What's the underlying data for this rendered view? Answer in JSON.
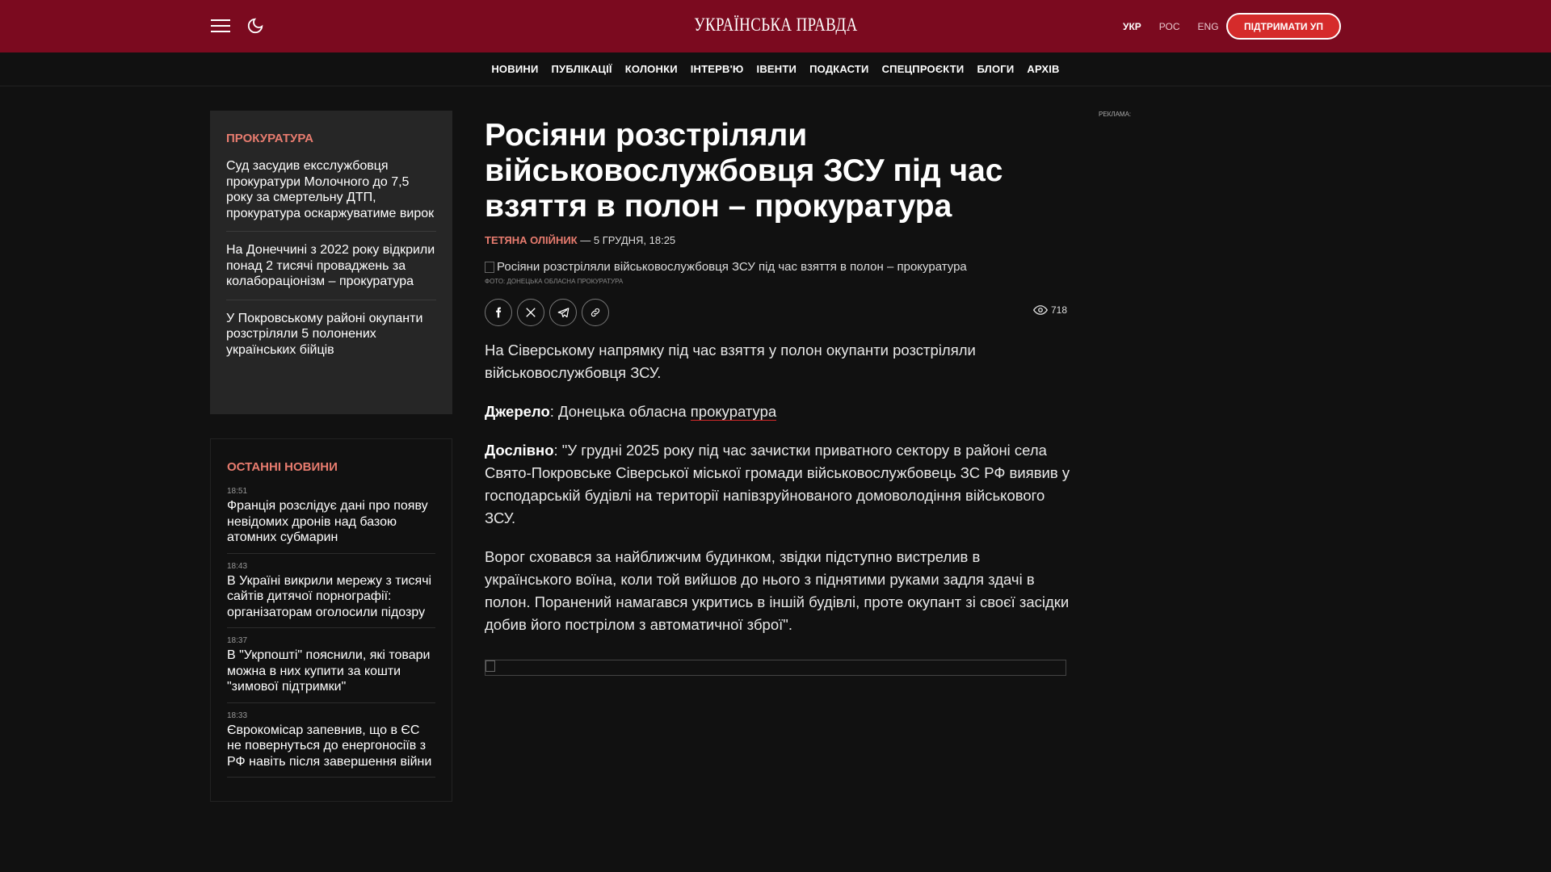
{
  "header": {
    "logo": "УКРАЇНСЬКА ПРАВДА",
    "languages": [
      "УКР",
      "РОС",
      "ENG"
    ],
    "support_label": "ПІДТРИМАТИ УП"
  },
  "nav": [
    "НОВИНИ",
    "ПУБЛІКАЦІЇ",
    "КОЛОНКИ",
    "ІНТЕРВ'Ю",
    "ІВЕНТИ",
    "ПОДКАСТИ",
    "СПЕЦПРОЄКТИ",
    "БЛОГИ",
    "АРХІВ"
  ],
  "sidebar_tag": {
    "title": "ПРОКУРАТУРА",
    "items": [
      "Суд засудив ексслужбовця прокуратури Молочного до 7,5 року за смертельну ДТП, прокуратура оскаржуватиме вирок",
      "На Донеччині з 2022 року відкрили понад 2 тисячі проваджень за колабораціонізм – прокуратура",
      "У Покровському районі окупанти розстріляли 5 полонених українських бійців"
    ]
  },
  "latest": {
    "title": "ОСТАННІ НОВИНИ",
    "items": [
      {
        "time": "18:51",
        "text": "Франція розслідує дані про появу невідомих дронів над базою атомних субмарин"
      },
      {
        "time": "18:43",
        "text": "В Україні викрили мережу з тисячі сайтів дитячої порнографії: організаторам оголосили підозру"
      },
      {
        "time": "18:37",
        "text": "В \"Укрпошті\" пояснили, які товари можна в них купити за кошти \"зимової підтримки\""
      },
      {
        "time": "18:33",
        "text": "Єврокомісар запевнив, що в ЄС не повернуться до енергоносіїв з РФ навіть після завершення війни"
      }
    ]
  },
  "article": {
    "title": "Росіяни розстріляли військовослужбовця ЗСУ під час взяття в полон – прокуратура",
    "author": "ТЕТЯНА ОЛІЙНИК",
    "date": " — 5 ГРУДНЯ, 18:25",
    "image_alt": "Росіяни розстріляли військовослужбовця ЗСУ під час взяття в полон – прокуратура",
    "caption": "ФОТО: ДОНЕЦЬКА ОБЛАСНА ПРОКУРАТУРА",
    "views": "718",
    "lead": "На Сіверському напрямку під час взяття у полон окупанти розстріляли військовослужбовця ЗСУ.",
    "source_label": "Джерело",
    "source_text": ": Донецька обласна ",
    "source_link": "прокуратура",
    "quote_label": "Дослівно",
    "quote_text": ": \"У грудні 2025 року під час зачистки приватного сектору в районі села Свято-Покровське Сіверської міської громади військовослужбовець ЗС РФ виявив у господарській будівлі на території напівзруйнованого домоволодіння військового ЗСУ.",
    "paragraph": "Ворог сховався за найближчим будинком, звідки підступно вистрелив в українського воїна, коли той вийшов до нього з піднятими руками задля здачі в полон. Поранений намагався укритись в іншій будівлі, проте окупант зі своєї засідки добив його пострілом з автоматичної зброї\"."
  },
  "ad_label": "РЕКЛАМА:",
  "colors": {
    "header_bg": "#7b0a1f",
    "accent": "#e87c6f",
    "support_bg": "#d52b2b"
  }
}
